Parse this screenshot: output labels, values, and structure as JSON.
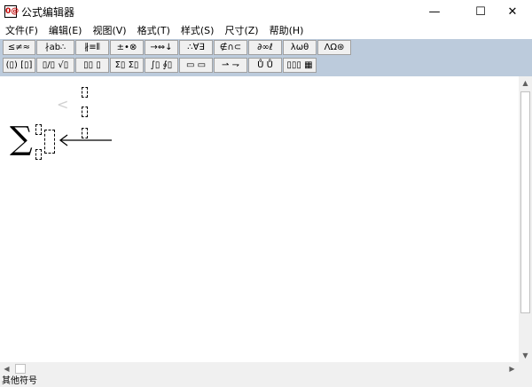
{
  "window": {
    "title": "公式编辑器",
    "icon_label": "0@",
    "minimize": "—",
    "maximize": "☐",
    "close": "✕"
  },
  "menu": [
    "文件(F)",
    "编辑(E)",
    "视图(V)",
    "格式(T)",
    "样式(S)",
    "尺寸(Z)",
    "帮助(H)"
  ],
  "toolbar": {
    "row1": [
      "≤≠≈",
      "∤ab∴",
      "∦≡⫴",
      "±•⊗",
      "→⇔↓",
      "∴∀∃",
      "∉∩⊂",
      "∂∞ℓ",
      "λωθ",
      "ΛΩ⊛"
    ],
    "row2": [
      "(▯) [▯]",
      "▯/▯ √▯",
      "▯▯ ▯",
      "Σ▯ Σ▯",
      "∫▯ ∮▯",
      "▭ ▭",
      "⇀ ⇁",
      "Ů Ů",
      "▯▯▯ ▦"
    ]
  },
  "equation": {
    "operator": "∑",
    "ghost_symbol": "<"
  },
  "status": {
    "text": "其他符号"
  },
  "scroll": {
    "up": "▲",
    "down": "▼",
    "left": "◀",
    "right": "▶"
  }
}
